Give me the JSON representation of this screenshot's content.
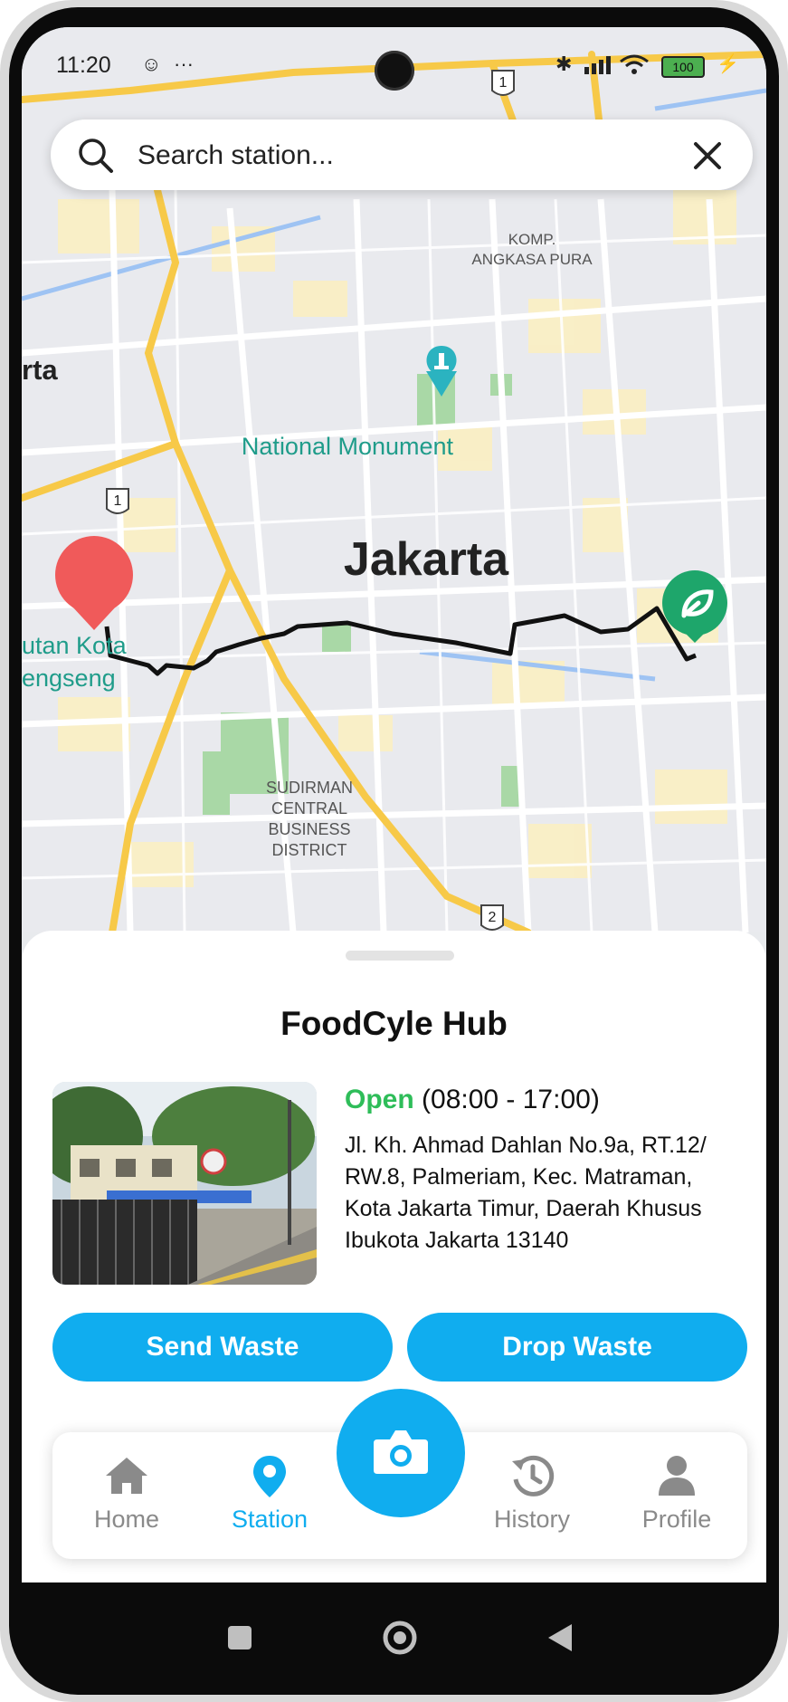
{
  "status_bar": {
    "time": "11:20",
    "extra": "···",
    "battery": "100"
  },
  "search": {
    "placeholder": "Search station..."
  },
  "map": {
    "labels": {
      "city": "Jakarta",
      "monument": "National Monument",
      "komp_line1": "KOMP.",
      "komp_line2": "ANGKASA PURA",
      "rta": "rta",
      "utan_line1": "utan Kota",
      "utan_line2": "engseng",
      "sudirman_line1": "SUDIRMAN",
      "sudirman_line2": "CENTRAL",
      "sudirman_line3": "BUSINESS",
      "sudirman_line4": "DISTRICT"
    },
    "road_shields": [
      "1",
      "1",
      "2"
    ],
    "colors": {
      "origin_pin": "#f05a5a",
      "station_pin": "#1ea66b",
      "route": "#111111",
      "road": "#f7c948"
    }
  },
  "station": {
    "name": "FoodCyle Hub",
    "status": "Open",
    "hours": "(08:00 - 17:00)",
    "address": "Jl. Kh. Ahmad Dahlan No.9a, RT.12/ RW.8, Palmeriam, Kec. Matraman, Kota Jakarta Timur, Daerah Khusus Ibukota Jakarta 13140"
  },
  "actions": {
    "send_label": "Send Waste",
    "drop_label": "Drop Waste"
  },
  "nav": {
    "items": [
      {
        "label": "Home",
        "icon": "home-icon",
        "active": false
      },
      {
        "label": "Station",
        "icon": "location-pin-icon",
        "active": true
      },
      {
        "label": "History",
        "icon": "history-icon",
        "active": false
      },
      {
        "label": "Profile",
        "icon": "profile-icon",
        "active": false
      }
    ],
    "center_icon": "camera-icon"
  },
  "theme": {
    "accent": "#10adef",
    "open_green": "#2ebd59"
  }
}
